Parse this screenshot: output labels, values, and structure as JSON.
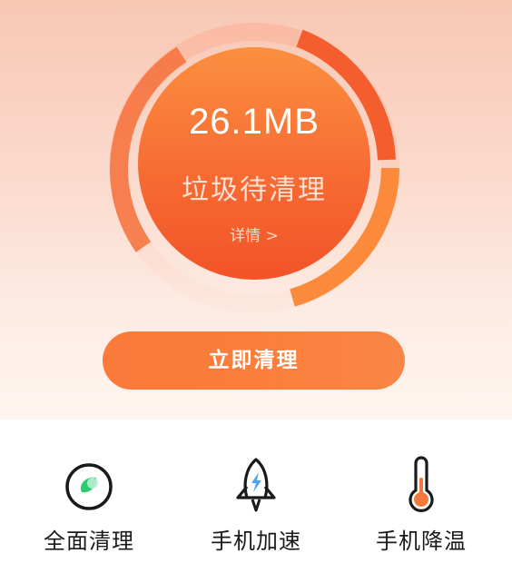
{
  "cleanup": {
    "junk_size": "26.1MB",
    "junk_label": "垃圾待清理",
    "details_link": "详情 >",
    "clean_now_button": "立即清理"
  },
  "tools": [
    {
      "label": "全面清理",
      "icon": "full-clean-icon"
    },
    {
      "label": "手机加速",
      "icon": "rocket-icon"
    },
    {
      "label": "手机降温",
      "icon": "thermometer-icon"
    }
  ],
  "colors": {
    "accent": "#fa7a3b",
    "circle_light": "#fb8a3d",
    "circle_dark": "#f05a2a",
    "green": "#2ecc71"
  }
}
